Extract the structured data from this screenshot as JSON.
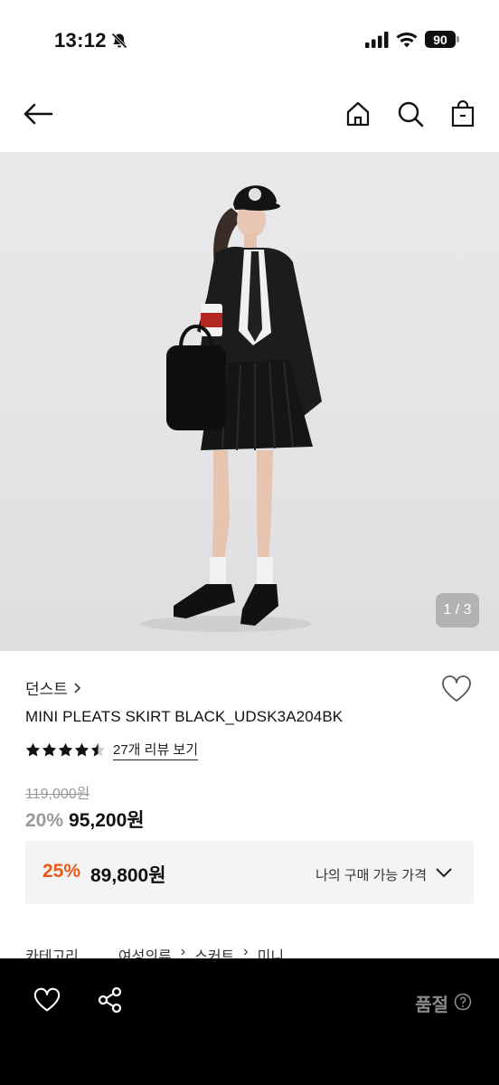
{
  "status": {
    "time": "13:12",
    "battery": "90"
  },
  "nav": {
    "icons": [
      "back-arrow-icon",
      "home-icon",
      "search-icon",
      "shopping-bag-icon"
    ]
  },
  "hero": {
    "counter": "1 / 3"
  },
  "product": {
    "brand": "던스트",
    "name": "MINI PLEATS SKIRT BLACK_UDSK3A204BK",
    "rating": 4.5,
    "review_link": "27개 리뷰 보기",
    "original_price": "119,000원",
    "discount_pct": "20%",
    "sale_price": "95,200원"
  },
  "benefit": {
    "pct": "25%",
    "price": "89,800원",
    "label": "나의 구매 가능 가격"
  },
  "category": {
    "label": "카테고리",
    "path": [
      "여성의류",
      "스커트",
      "미니"
    ]
  },
  "bottom": {
    "status": "품절"
  },
  "colors": {
    "accent": "#e85a1b",
    "bottom_bar": "#000000",
    "muted": "#9a9a9a"
  }
}
